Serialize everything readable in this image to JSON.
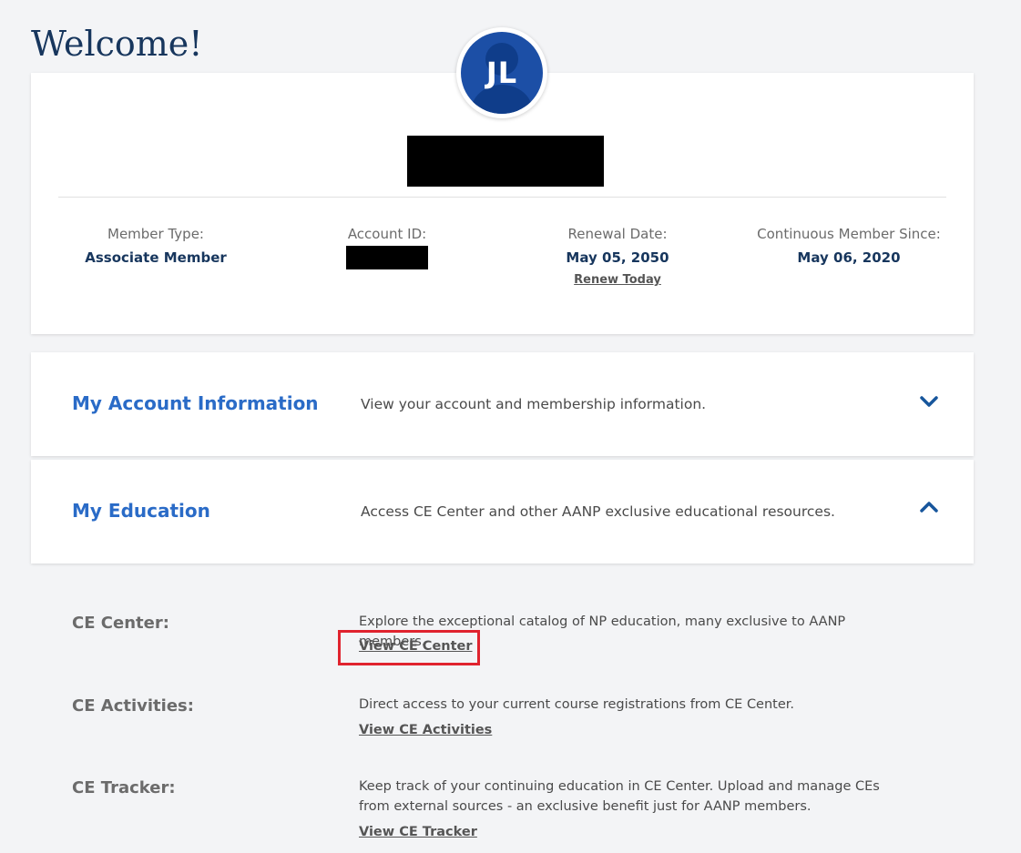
{
  "page": {
    "welcome": "Welcome!"
  },
  "profile": {
    "initials": "JL",
    "fields": [
      {
        "label": "Member Type:",
        "value": "Associate Member"
      },
      {
        "label": "Account ID:",
        "value": ""
      },
      {
        "label": "Renewal Date:",
        "value": "May 05, 2050",
        "link": "Renew Today"
      },
      {
        "label": "Continuous Member Since:",
        "value": "May 06, 2020"
      }
    ]
  },
  "sections": {
    "account": {
      "title": "My Account Information",
      "description": "View your account and membership information.",
      "state": "collapsed"
    },
    "education": {
      "title": "My Education",
      "description": "Access CE Center and other AANP exclusive educational resources.",
      "state": "expanded"
    }
  },
  "education_items": [
    {
      "label": "CE Center:",
      "description": "Explore the exceptional catalog of NP education, many exclusive to AANP members.",
      "link": "View CE Center"
    },
    {
      "label": "CE Activities:",
      "description": "Direct access to your current course registrations from CE Center.",
      "link": "View CE Activities"
    },
    {
      "label": "CE Tracker:",
      "description": "Keep track of your continuing education in CE Center. Upload and manage CEs from external sources - an exclusive benefit just for AANP members.",
      "link": "View CE Tracker"
    }
  ],
  "colors": {
    "accent": "#2a6bc7",
    "navy": "#17365d",
    "avatar": "#1c4fa6",
    "highlight": "#e0232e"
  },
  "icons": {
    "expand": "chevron-down-icon",
    "collapse": "chevron-up-icon",
    "avatar": "person-silhouette-icon"
  }
}
